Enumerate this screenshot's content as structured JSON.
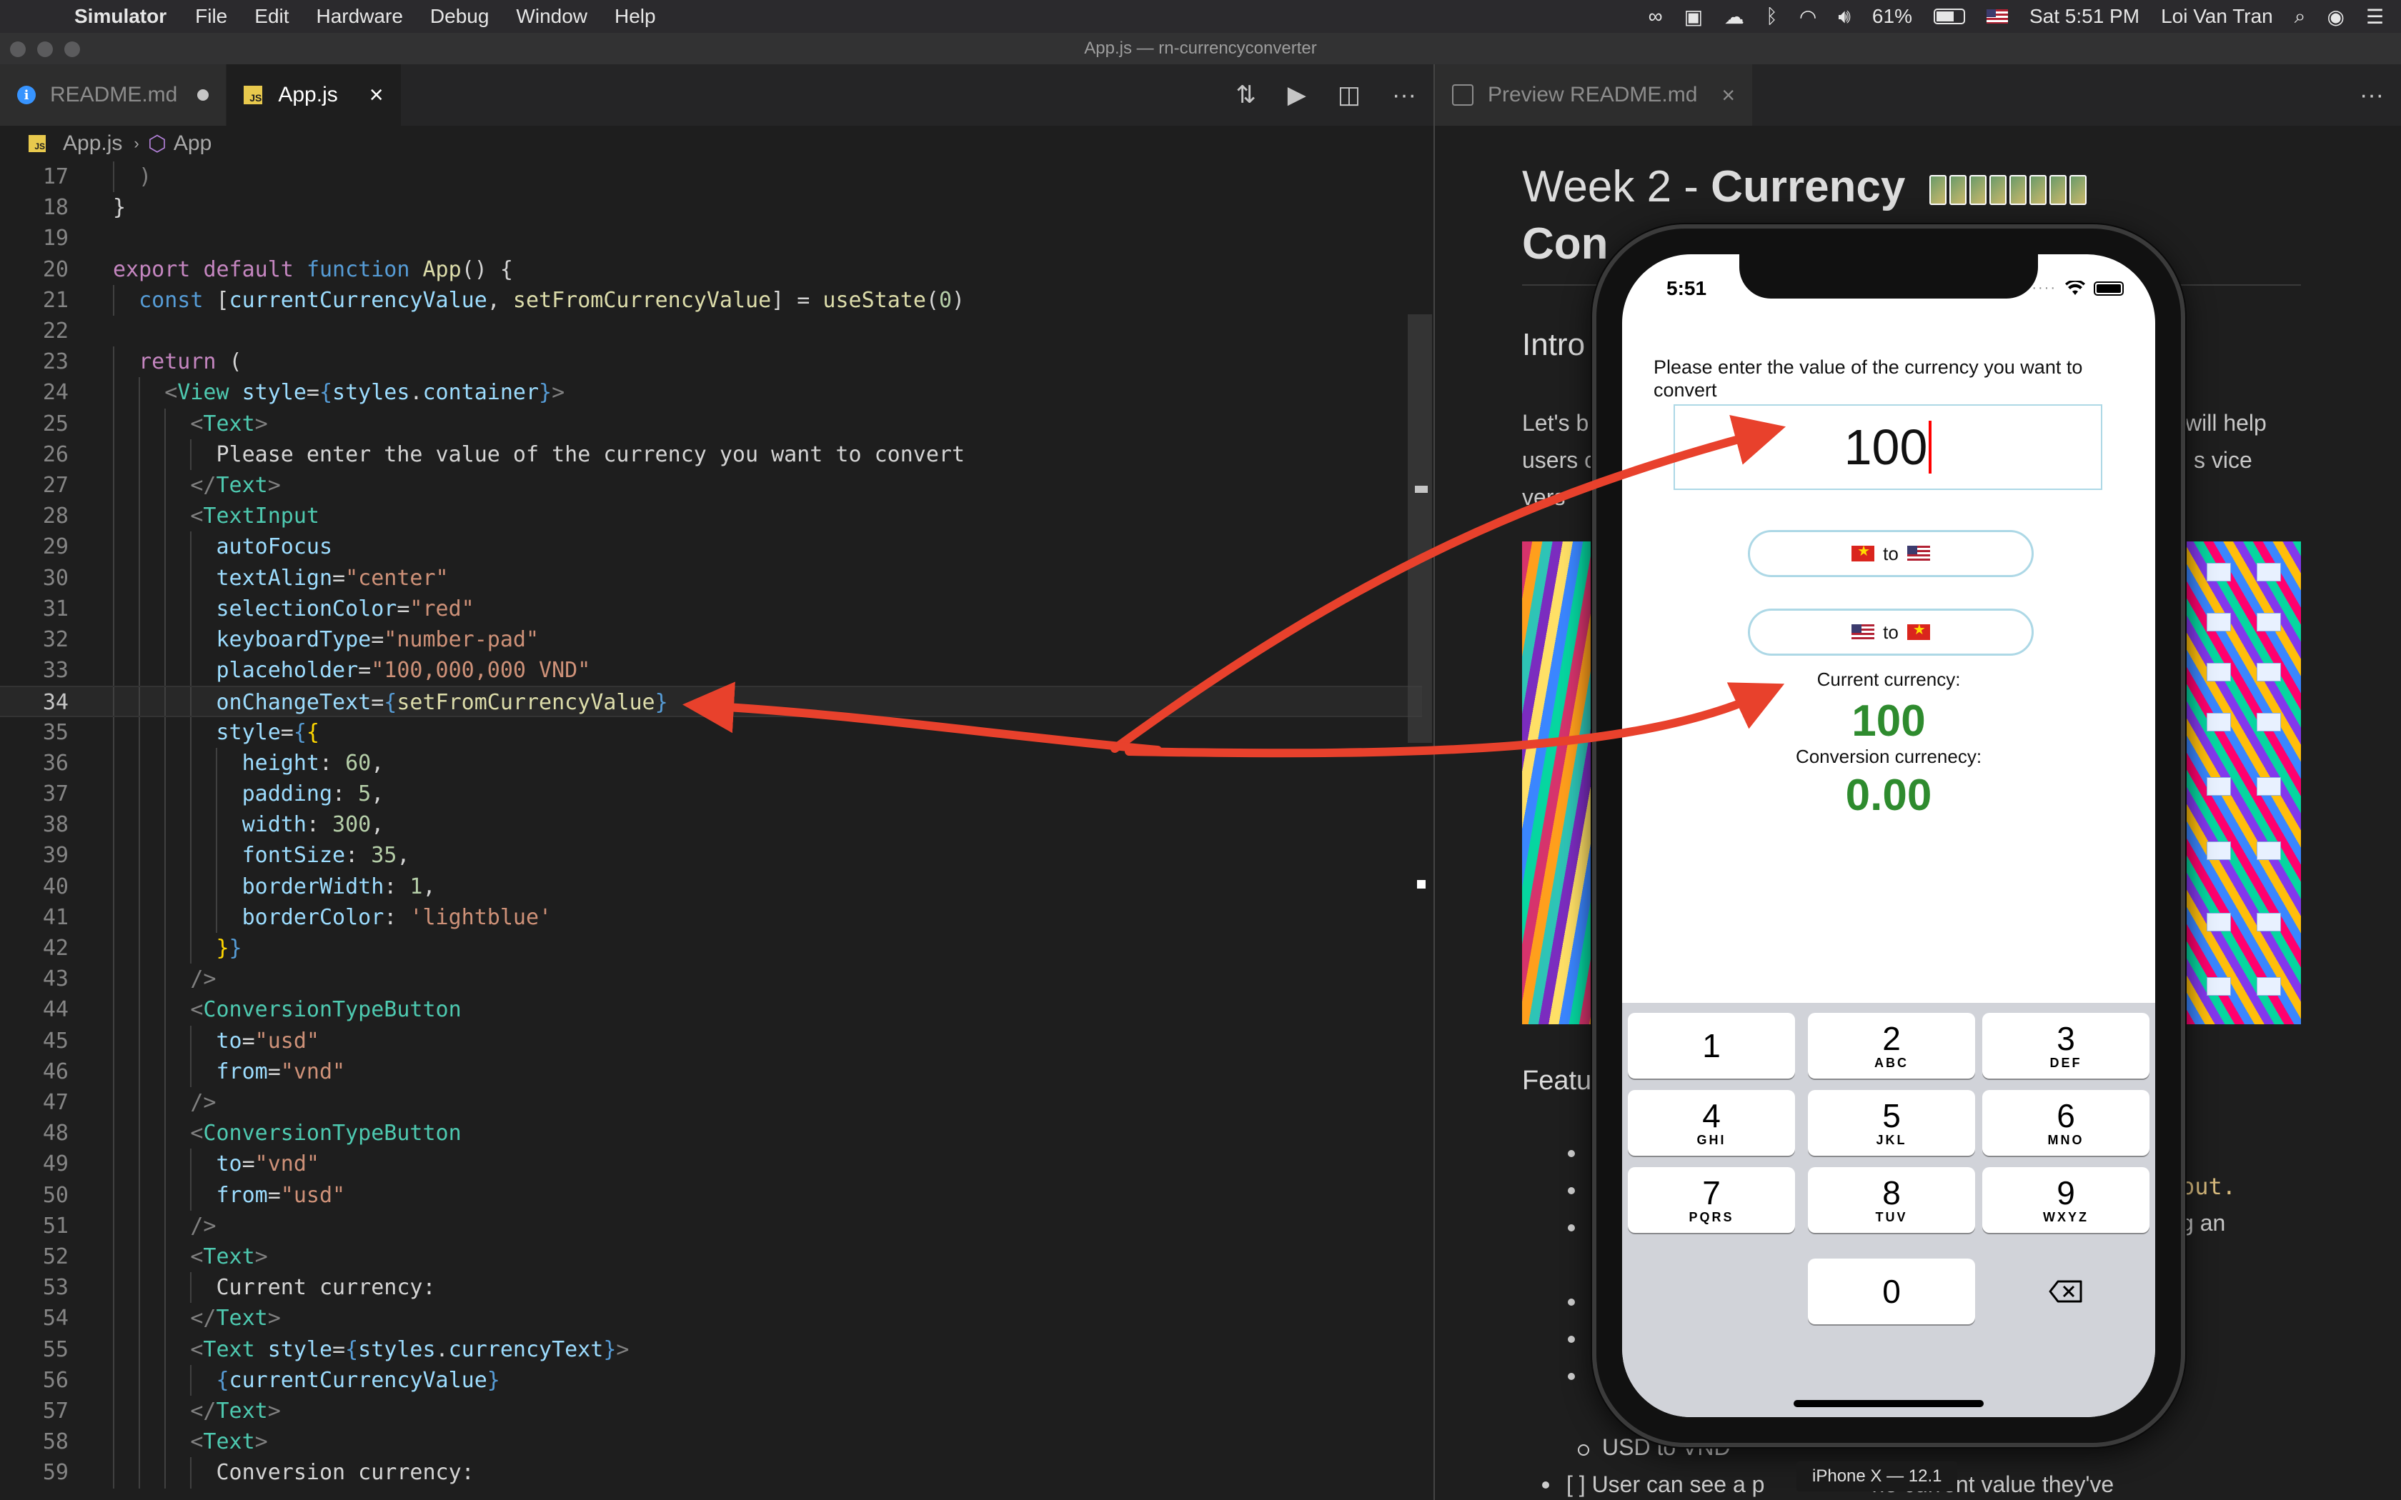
{
  "menubar": {
    "app_name": "Simulator",
    "menus": [
      "File",
      "Edit",
      "Hardware",
      "Debug",
      "Window",
      "Help"
    ],
    "battery": "61%",
    "datetime": "Sat 5:51 PM",
    "user": "Loi Van Tran"
  },
  "window": {
    "title": "App.js — rn-currencyconverter"
  },
  "editor": {
    "tabs": [
      {
        "label": "README.md",
        "modified": true
      },
      {
        "label": "App.js",
        "active": true
      }
    ],
    "breadcrumb": {
      "file": "App.js",
      "symbol": "App"
    },
    "current_line": 34,
    "lines": [
      {
        "n": "17",
        "indent": 1,
        "tokens": [
          [
            "t-pun",
            ")"
          ]
        ]
      },
      {
        "n": "18",
        "indent": 0,
        "tokens": [
          [
            "t-text",
            "}"
          ]
        ]
      },
      {
        "n": "19",
        "indent": 0,
        "tokens": []
      },
      {
        "n": "20",
        "indent": 0,
        "tokens": [
          [
            "t-kw",
            "export"
          ],
          [
            "t-text",
            " "
          ],
          [
            "t-kw",
            "default"
          ],
          [
            "t-text",
            " "
          ],
          [
            "t-st",
            "function"
          ],
          [
            "t-text",
            " "
          ],
          [
            "t-fn",
            "App"
          ],
          [
            "t-text",
            "() {"
          ]
        ]
      },
      {
        "n": "21",
        "indent": 1,
        "tokens": [
          [
            "t-st",
            "const"
          ],
          [
            "t-text",
            " ["
          ],
          [
            "t-var",
            "currentCurrencyValue"
          ],
          [
            "t-text",
            ", "
          ],
          [
            "t-fn",
            "setFromCurrencyValue"
          ],
          [
            "t-text",
            "] = "
          ],
          [
            "t-fn",
            "useState"
          ],
          [
            "t-text",
            "("
          ],
          [
            "t-num",
            "0"
          ],
          [
            "t-text",
            ")"
          ]
        ]
      },
      {
        "n": "22",
        "indent": 0,
        "tokens": []
      },
      {
        "n": "23",
        "indent": 1,
        "tokens": [
          [
            "t-kw",
            "return"
          ],
          [
            "t-text",
            " ("
          ]
        ]
      },
      {
        "n": "24",
        "indent": 2,
        "tokens": [
          [
            "t-pun",
            "<"
          ],
          [
            "t-tag",
            "View"
          ],
          [
            "t-text",
            " "
          ],
          [
            "t-var",
            "style"
          ],
          [
            "t-text",
            "="
          ],
          [
            "t-st",
            "{"
          ],
          [
            "t-var",
            "styles"
          ],
          [
            "t-text",
            "."
          ],
          [
            "t-var",
            "container"
          ],
          [
            "t-st",
            "}"
          ],
          [
            "t-pun",
            ">"
          ]
        ]
      },
      {
        "n": "25",
        "indent": 3,
        "tokens": [
          [
            "t-pun",
            "<"
          ],
          [
            "t-tag",
            "Text"
          ],
          [
            "t-pun",
            ">"
          ]
        ]
      },
      {
        "n": "26",
        "indent": 4,
        "tokens": [
          [
            "t-text",
            "Please enter the value of the currency you want to convert"
          ]
        ]
      },
      {
        "n": "27",
        "indent": 3,
        "tokens": [
          [
            "t-pun",
            "</"
          ],
          [
            "t-tag",
            "Text"
          ],
          [
            "t-pun",
            ">"
          ]
        ]
      },
      {
        "n": "28",
        "indent": 3,
        "tokens": [
          [
            "t-pun",
            "<"
          ],
          [
            "t-tag",
            "TextInput"
          ]
        ]
      },
      {
        "n": "29",
        "indent": 4,
        "tokens": [
          [
            "t-var",
            "autoFocus"
          ]
        ]
      },
      {
        "n": "30",
        "indent": 4,
        "tokens": [
          [
            "t-var",
            "textAlign"
          ],
          [
            "t-text",
            "="
          ],
          [
            "t-str",
            "\"center\""
          ]
        ]
      },
      {
        "n": "31",
        "indent": 4,
        "tokens": [
          [
            "t-var",
            "selectionColor"
          ],
          [
            "t-text",
            "="
          ],
          [
            "t-str",
            "\"red\""
          ]
        ]
      },
      {
        "n": "32",
        "indent": 4,
        "tokens": [
          [
            "t-var",
            "keyboardType"
          ],
          [
            "t-text",
            "="
          ],
          [
            "t-str",
            "\"number-pad\""
          ]
        ]
      },
      {
        "n": "33",
        "indent": 4,
        "tokens": [
          [
            "t-var",
            "placeholder"
          ],
          [
            "t-text",
            "="
          ],
          [
            "t-str",
            "\"100,000,000 VND\""
          ]
        ]
      },
      {
        "n": "34",
        "indent": 4,
        "tokens": [
          [
            "t-var",
            "onChangeText"
          ],
          [
            "t-text",
            "="
          ],
          [
            "t-st",
            "{"
          ],
          [
            "t-fn",
            "setFromCurrencyValue"
          ],
          [
            "t-st",
            "}"
          ]
        ]
      },
      {
        "n": "35",
        "indent": 4,
        "tokens": [
          [
            "t-var",
            "style"
          ],
          [
            "t-text",
            "="
          ],
          [
            "t-st",
            "{"
          ],
          [
            "t-brace",
            "{"
          ]
        ]
      },
      {
        "n": "36",
        "indent": 5,
        "tokens": [
          [
            "t-var",
            "height"
          ],
          [
            "t-text",
            ": "
          ],
          [
            "t-num",
            "60"
          ],
          [
            "t-text",
            ","
          ]
        ]
      },
      {
        "n": "37",
        "indent": 5,
        "tokens": [
          [
            "t-var",
            "padding"
          ],
          [
            "t-text",
            ": "
          ],
          [
            "t-num",
            "5"
          ],
          [
            "t-text",
            ","
          ]
        ]
      },
      {
        "n": "38",
        "indent": 5,
        "tokens": [
          [
            "t-var",
            "width"
          ],
          [
            "t-text",
            ": "
          ],
          [
            "t-num",
            "300"
          ],
          [
            "t-text",
            ","
          ]
        ]
      },
      {
        "n": "39",
        "indent": 5,
        "tokens": [
          [
            "t-var",
            "fontSize"
          ],
          [
            "t-text",
            ": "
          ],
          [
            "t-num",
            "35"
          ],
          [
            "t-text",
            ","
          ]
        ]
      },
      {
        "n": "40",
        "indent": 5,
        "tokens": [
          [
            "t-var",
            "borderWidth"
          ],
          [
            "t-text",
            ": "
          ],
          [
            "t-num",
            "1"
          ],
          [
            "t-text",
            ","
          ]
        ]
      },
      {
        "n": "41",
        "indent": 5,
        "tokens": [
          [
            "t-var",
            "borderColor"
          ],
          [
            "t-text",
            ": "
          ],
          [
            "t-str",
            "'lightblue'"
          ]
        ]
      },
      {
        "n": "42",
        "indent": 4,
        "tokens": [
          [
            "t-brace",
            "}"
          ],
          [
            "t-st",
            "}"
          ]
        ]
      },
      {
        "n": "43",
        "indent": 3,
        "tokens": [
          [
            "t-pun",
            "/>"
          ]
        ]
      },
      {
        "n": "44",
        "indent": 3,
        "tokens": [
          [
            "t-pun",
            "<"
          ],
          [
            "t-tag",
            "ConversionTypeButton"
          ]
        ]
      },
      {
        "n": "45",
        "indent": 4,
        "tokens": [
          [
            "t-var",
            "to"
          ],
          [
            "t-text",
            "="
          ],
          [
            "t-str",
            "\"usd\""
          ]
        ]
      },
      {
        "n": "46",
        "indent": 4,
        "tokens": [
          [
            "t-var",
            "from"
          ],
          [
            "t-text",
            "="
          ],
          [
            "t-str",
            "\"vnd\""
          ]
        ]
      },
      {
        "n": "47",
        "indent": 3,
        "tokens": [
          [
            "t-pun",
            "/>"
          ]
        ]
      },
      {
        "n": "48",
        "indent": 3,
        "tokens": [
          [
            "t-pun",
            "<"
          ],
          [
            "t-tag",
            "ConversionTypeButton"
          ]
        ]
      },
      {
        "n": "49",
        "indent": 4,
        "tokens": [
          [
            "t-var",
            "to"
          ],
          [
            "t-text",
            "="
          ],
          [
            "t-str",
            "\"vnd\""
          ]
        ]
      },
      {
        "n": "50",
        "indent": 4,
        "tokens": [
          [
            "t-var",
            "from"
          ],
          [
            "t-text",
            "="
          ],
          [
            "t-str",
            "\"usd\""
          ]
        ]
      },
      {
        "n": "51",
        "indent": 3,
        "tokens": [
          [
            "t-pun",
            "/>"
          ]
        ]
      },
      {
        "n": "52",
        "indent": 3,
        "tokens": [
          [
            "t-pun",
            "<"
          ],
          [
            "t-tag",
            "Text"
          ],
          [
            "t-pun",
            ">"
          ]
        ]
      },
      {
        "n": "53",
        "indent": 4,
        "tokens": [
          [
            "t-text",
            "Current currency:"
          ]
        ]
      },
      {
        "n": "54",
        "indent": 3,
        "tokens": [
          [
            "t-pun",
            "</"
          ],
          [
            "t-tag",
            "Text"
          ],
          [
            "t-pun",
            ">"
          ]
        ]
      },
      {
        "n": "55",
        "indent": 3,
        "tokens": [
          [
            "t-pun",
            "<"
          ],
          [
            "t-tag",
            "Text"
          ],
          [
            "t-text",
            " "
          ],
          [
            "t-var",
            "style"
          ],
          [
            "t-text",
            "="
          ],
          [
            "t-st",
            "{"
          ],
          [
            "t-var",
            "styles"
          ],
          [
            "t-text",
            "."
          ],
          [
            "t-var",
            "currencyText"
          ],
          [
            "t-st",
            "}"
          ],
          [
            "t-pun",
            ">"
          ]
        ]
      },
      {
        "n": "56",
        "indent": 4,
        "tokens": [
          [
            "t-st",
            "{"
          ],
          [
            "t-var",
            "currentCurrencyValue"
          ],
          [
            "t-st",
            "}"
          ]
        ]
      },
      {
        "n": "57",
        "indent": 3,
        "tokens": [
          [
            "t-pun",
            "</"
          ],
          [
            "t-tag",
            "Text"
          ],
          [
            "t-pun",
            ">"
          ]
        ]
      },
      {
        "n": "58",
        "indent": 3,
        "tokens": [
          [
            "t-pun",
            "<"
          ],
          [
            "t-tag",
            "Text"
          ],
          [
            "t-pun",
            ">"
          ]
        ]
      },
      {
        "n": "59",
        "indent": 4,
        "tokens": [
          [
            "t-text",
            "Conversion currency:"
          ]
        ]
      }
    ]
  },
  "preview": {
    "tab_label": "Preview README.md",
    "h1_a": "Week 2 - ",
    "h1_b": "Currency",
    "h1_c": "Con",
    "intro": "Intro",
    "para_a": "Let's b",
    "para_b": "users c",
    "para_c": "vers",
    "para_right_a": "will help",
    "para_right_b": "s vice",
    "features": "Featu",
    "frag_out": "out.",
    "frag_gan": "g an",
    "sub_bullet": "USD to VND",
    "task_a": "[ ] User can see a p",
    "task_b": "he current value they've"
  },
  "simulator": {
    "time": "5:51",
    "prompt": "Please enter the value of the currency you want to convert",
    "input_value": "100",
    "btn_to": "to",
    "current_label": "Current currency:",
    "current_value": "100",
    "conversion_label": "Conversion currenecy:",
    "conversion_value": "0.00",
    "keys": [
      {
        "d": "1",
        "l": ""
      },
      {
        "d": "2",
        "l": "ABC"
      },
      {
        "d": "3",
        "l": "DEF"
      },
      {
        "d": "4",
        "l": "GHI"
      },
      {
        "d": "5",
        "l": "JKL"
      },
      {
        "d": "6",
        "l": "MNO"
      },
      {
        "d": "7",
        "l": "PQRS"
      },
      {
        "d": "8",
        "l": "TUV"
      },
      {
        "d": "9",
        "l": "WXYZ"
      }
    ],
    "zero_key": "0",
    "device_label": "iPhone X — 12.1"
  },
  "colors": {
    "annotation_arrow": "#e8412c",
    "currency_green": "#2e8b2e",
    "input_border": "#add8e6"
  }
}
